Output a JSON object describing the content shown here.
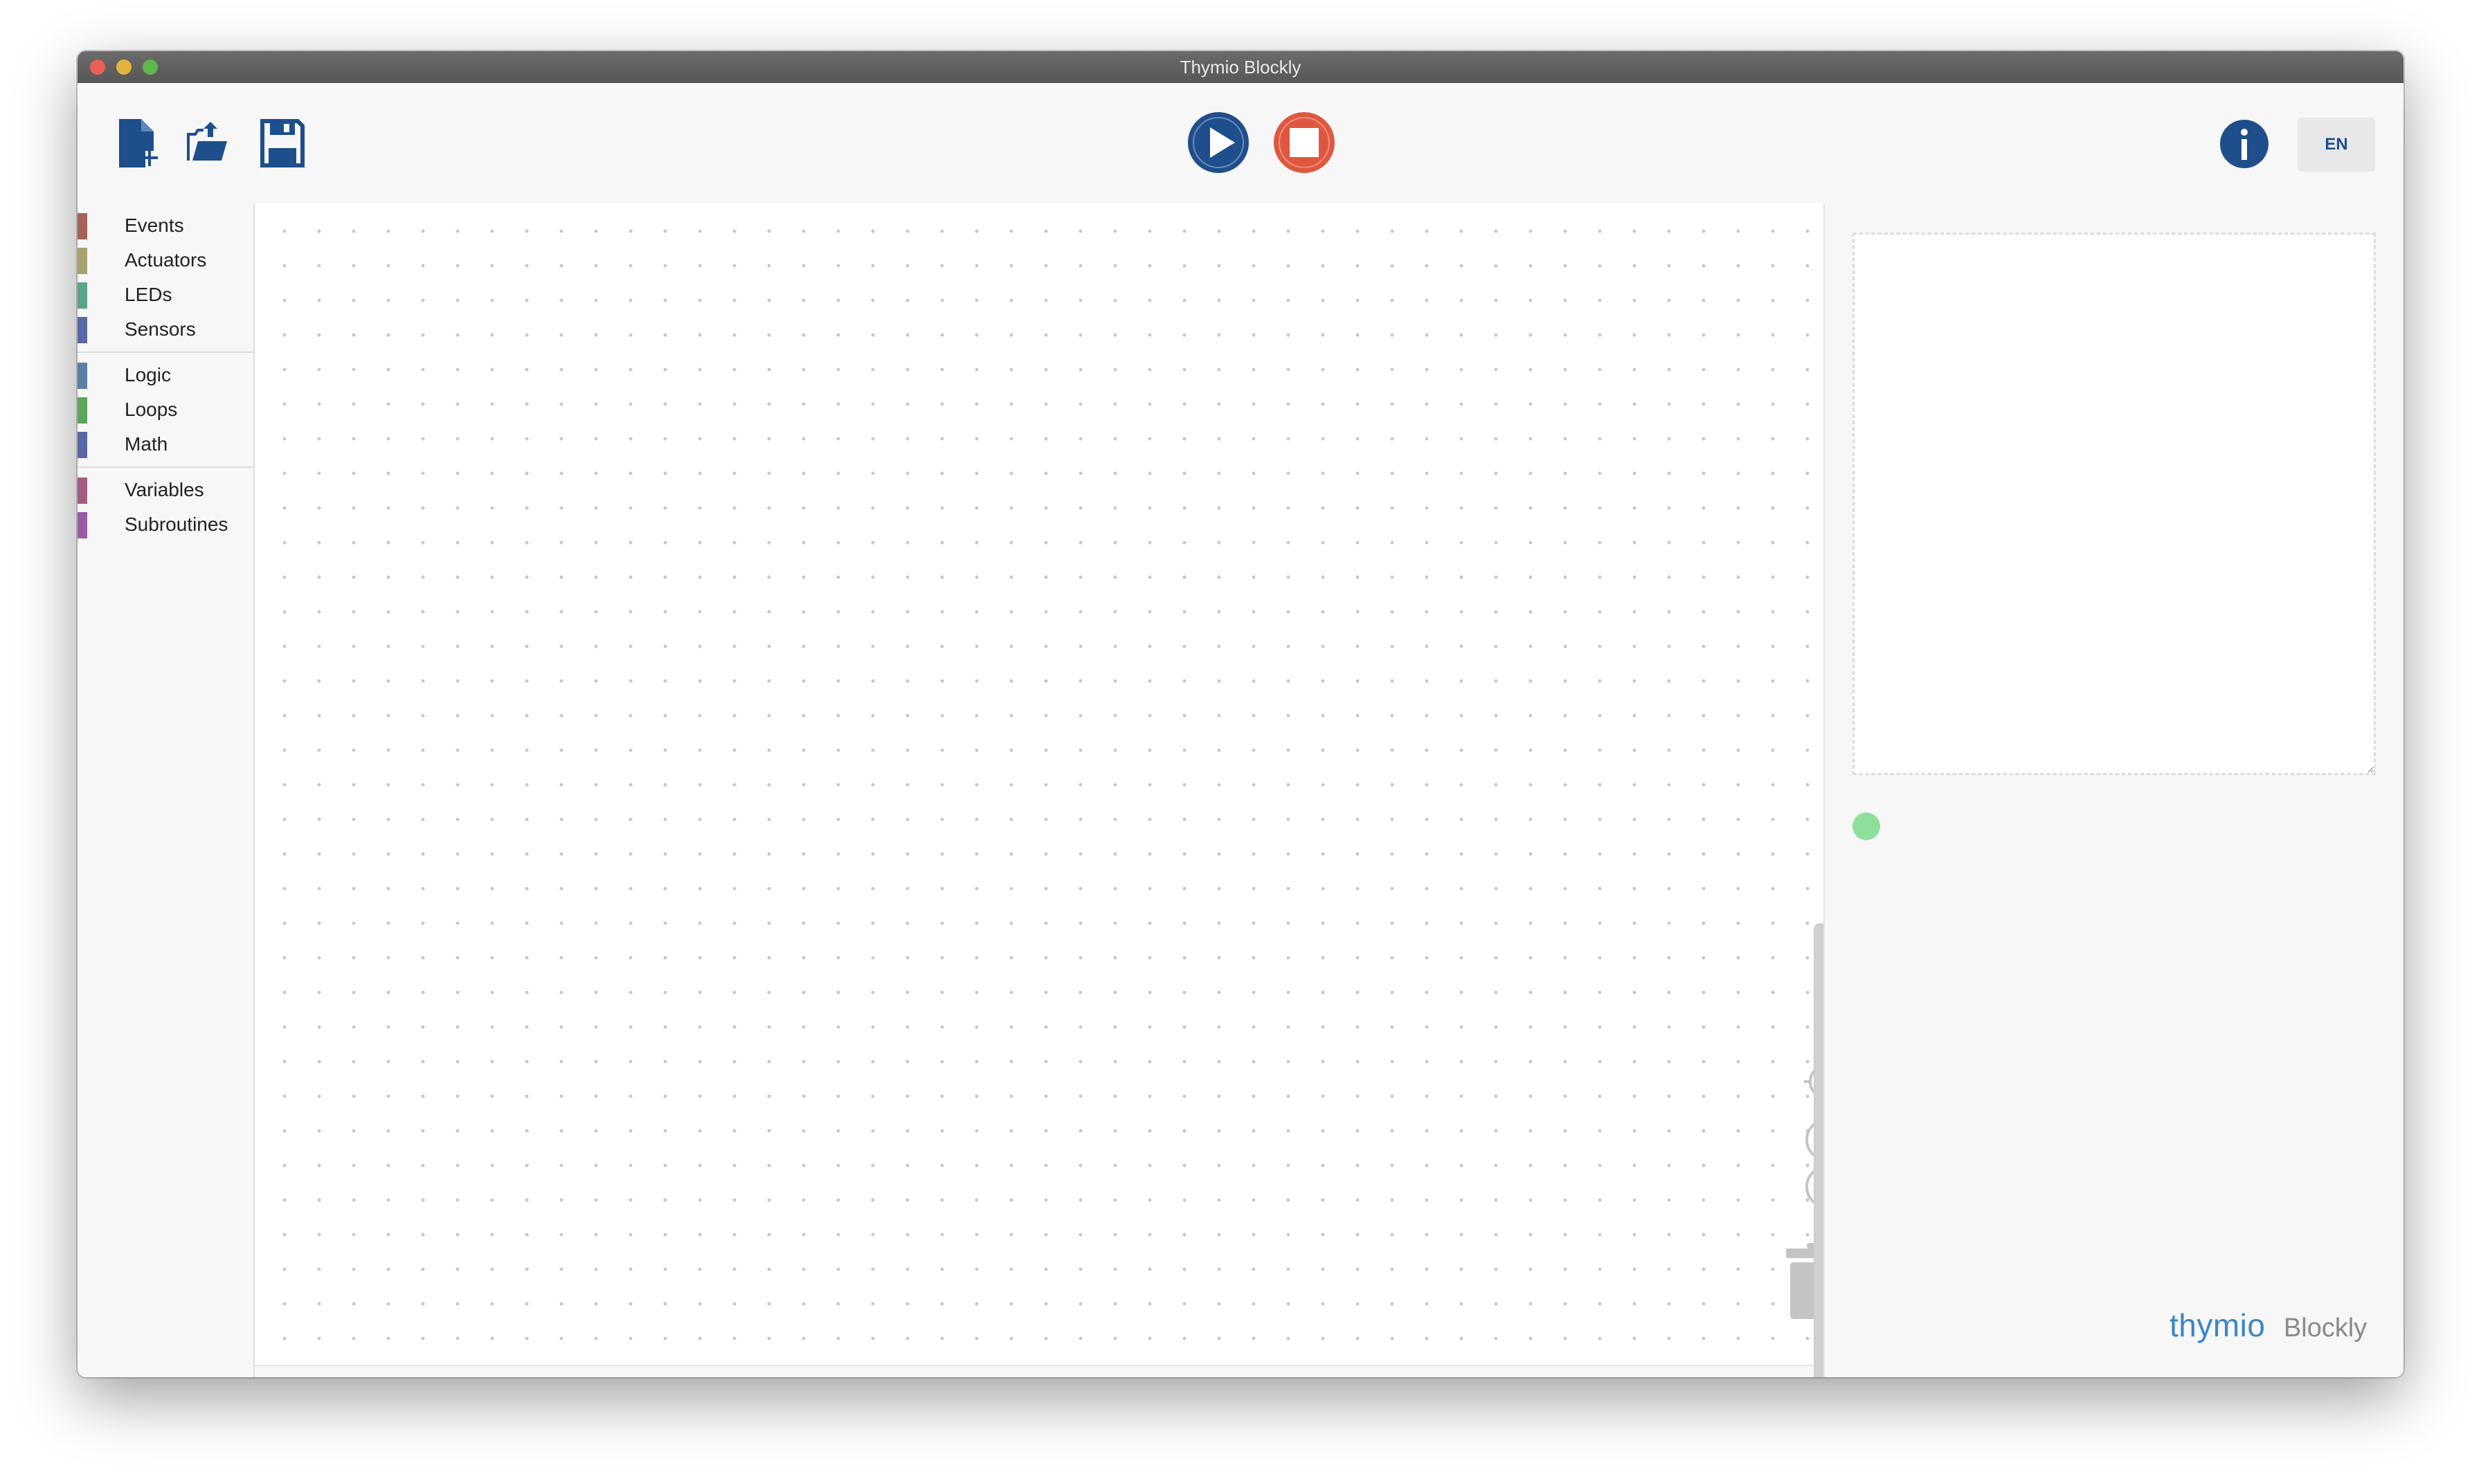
{
  "window": {
    "title": "Thymio Blockly"
  },
  "toolbar": {
    "new_icon": "new-file-icon",
    "open_icon": "open-folder-icon",
    "save_icon": "save-disk-icon",
    "run_icon": "play-icon",
    "stop_icon": "stop-icon",
    "info_icon": "info-icon",
    "language": "EN"
  },
  "sidebar": {
    "groups": [
      [
        {
          "label": "Events",
          "color": "#a5625b"
        },
        {
          "label": "Actuators",
          "color": "#a5a26b"
        },
        {
          "label": "LEDs",
          "color": "#5ba58b"
        },
        {
          "label": "Sensors",
          "color": "#5b67a5"
        }
      ],
      [
        {
          "label": "Logic",
          "color": "#5b80a5"
        },
        {
          "label": "Loops",
          "color": "#5ba55b"
        },
        {
          "label": "Math",
          "color": "#5b67a5"
        }
      ],
      [
        {
          "label": "Variables",
          "color": "#a55b80"
        },
        {
          "label": "Subroutines",
          "color": "#995ba5"
        }
      ]
    ]
  },
  "workspace": {
    "controls": [
      "recenter-icon",
      "zoom-in-icon",
      "zoom-out-icon",
      "trash-icon"
    ]
  },
  "right_panel": {
    "code_text": "",
    "status_color": "#8fdf9c",
    "brand_name": "thymio",
    "brand_suffix": "Blockly"
  },
  "colors": {
    "primary": "#1f4e8c",
    "stop": "#e0573f"
  }
}
